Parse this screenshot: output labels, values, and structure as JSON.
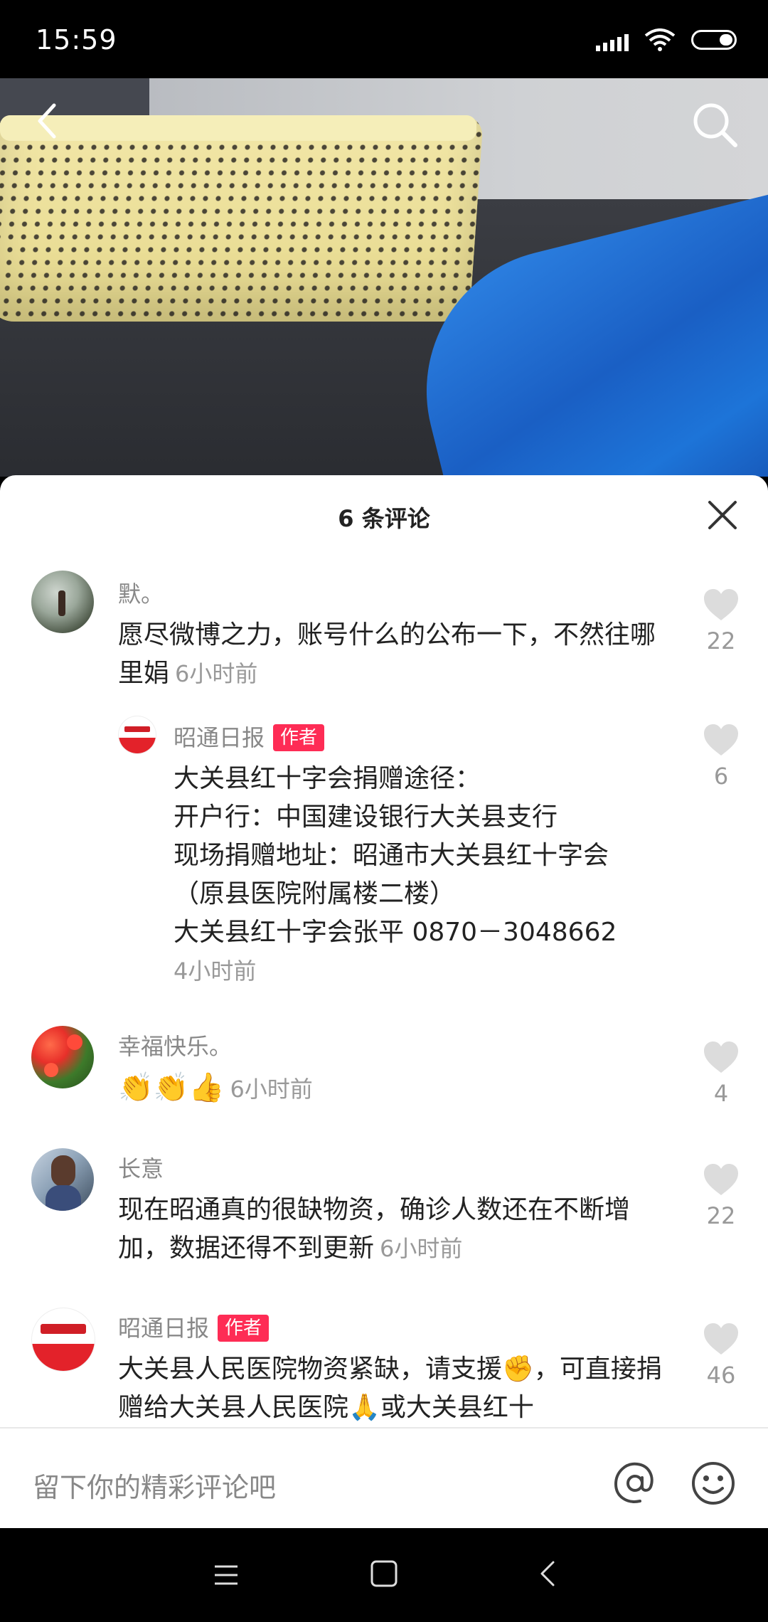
{
  "status_bar": {
    "time": "15:59"
  },
  "sheet": {
    "title": "6 条评论"
  },
  "comments": [
    {
      "user": "默。",
      "text": "愿尽微博之力，账号什么的公布一下，不然往哪里娟",
      "time": "6小时前",
      "likes": "22"
    },
    {
      "user": "昭通日报",
      "badge": "作者",
      "lines": [
        "大关县红十字会捐赠途径：",
        "开户行：中国建设银行大关县支行",
        "现场捐赠地址：昭通市大关县红十字会",
        "（原县医院附属楼二楼）",
        "大关县红十字会张平 0870－3048662"
      ],
      "time": "4小时前",
      "likes": "6"
    },
    {
      "user": "幸福快乐。",
      "emojis": [
        "👏",
        "👏",
        "👍"
      ],
      "time": "6小时前",
      "likes": "4"
    },
    {
      "user": "长意",
      "text": "现在昭通真的很缺物资，确诊人数还在不断增加，数据还得不到更新",
      "time": "6小时前",
      "likes": "22"
    },
    {
      "user": "昭通日报",
      "badge": "作者",
      "text_a": "大关县人民医院物资紧缺，请支援",
      "emoji_a": "✊",
      "text_b": "，可直接捐赠给大关县人民医院",
      "emoji_b": "🙏",
      "text_c": "或大关县红十",
      "likes": "46"
    }
  ],
  "input": {
    "placeholder": "留下你的精彩评论吧"
  },
  "colors": {
    "accent": "#fe2c55",
    "icon_gray": "#dcdcdc"
  }
}
